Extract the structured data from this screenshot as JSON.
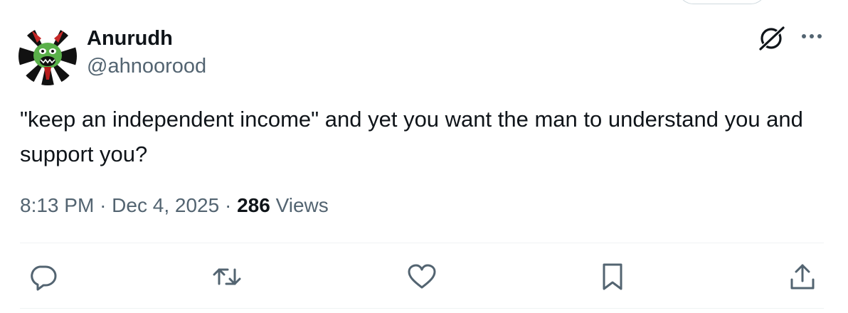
{
  "author": {
    "name": "Anurudh",
    "handle": "@ahnoorood"
  },
  "tweet": {
    "text": "\"keep an independent income\" and yet you want the man to understand you and support you?"
  },
  "meta": {
    "time": "8:13 PM",
    "separator": "·",
    "date": "Dec 4, 2025",
    "views_count": "286",
    "views_label": "Views"
  },
  "icons": {
    "grok": "grok-icon",
    "more": "more-icon",
    "reply": "reply-icon",
    "retweet": "retweet-icon",
    "like": "heart-icon",
    "bookmark": "bookmark-icon",
    "share": "share-icon"
  },
  "colors": {
    "text_primary": "#0f1419",
    "text_secondary": "#536471",
    "icon": "#536471",
    "divider": "#eff3f4"
  }
}
